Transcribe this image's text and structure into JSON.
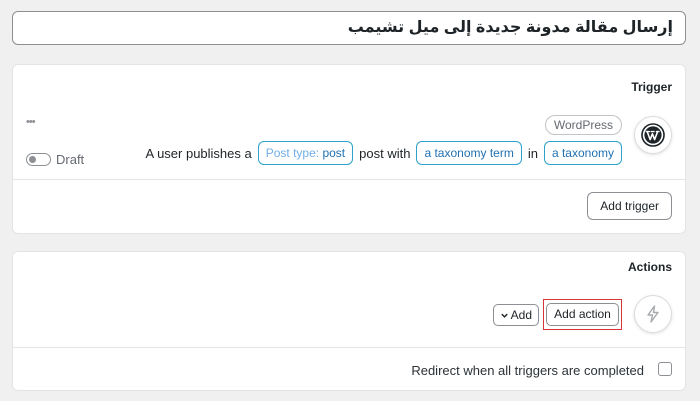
{
  "post_title": "إرسال مقالة مدونة جديدة إلى ميل تشيمب",
  "trigger_panel": {
    "title": "Trigger",
    "item": {
      "menu_glyph": "•••",
      "status_label": "Draft",
      "integration_badge": "WordPress",
      "icon": "wordpress-icon",
      "sentence": {
        "part1": "A user publishes a",
        "chip1_key": "Post type:",
        "chip1_value": "post",
        "part2": "post with",
        "chip2": "a taxonomy term",
        "part3": "in",
        "chip3": "a taxonomy"
      }
    },
    "add_trigger_label": "Add trigger"
  },
  "actions_panel": {
    "title": "Actions",
    "add_dropdown_label": "Add",
    "add_action_label": "Add action",
    "icon": "bolt-icon",
    "redirect_label": "Redirect when all triggers are completed"
  },
  "colors": {
    "background": "#f0f0f1",
    "chip_border": "#2ea2cc",
    "chip_text": "#2271b1",
    "highlight": "#d63638"
  }
}
